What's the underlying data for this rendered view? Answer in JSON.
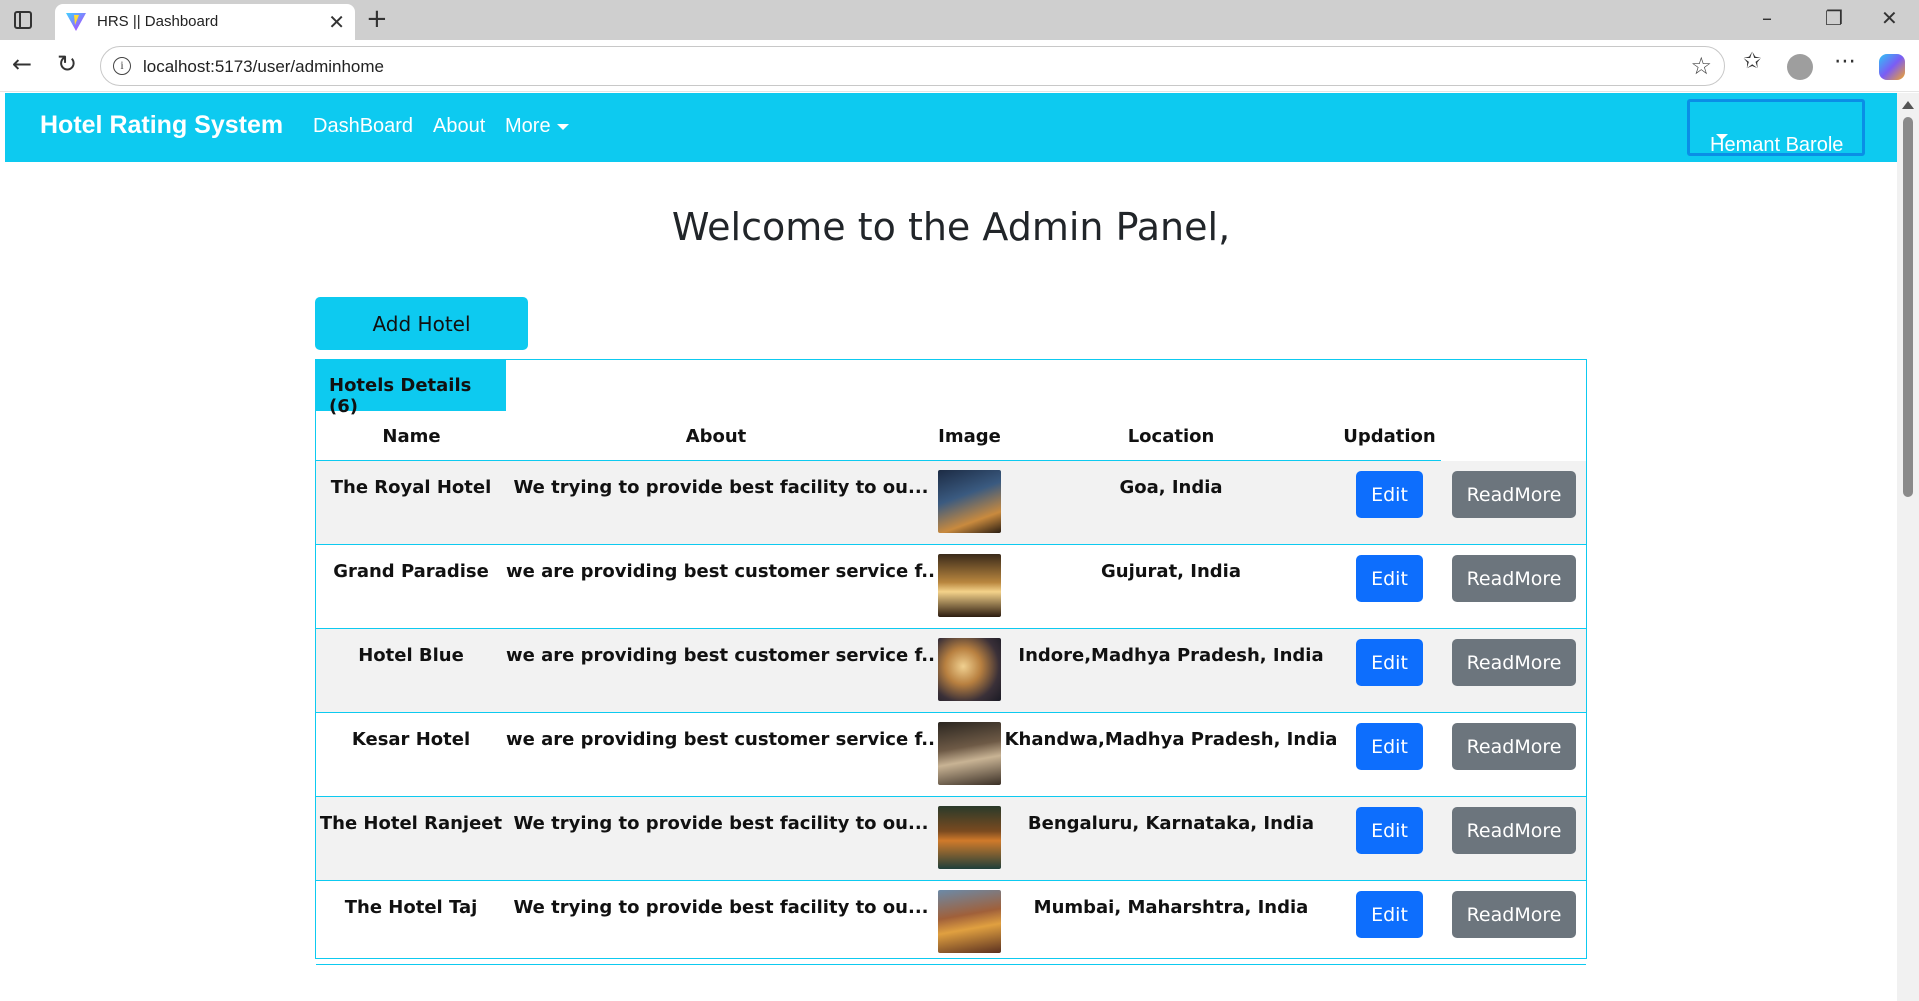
{
  "browser": {
    "tab_title": "HRS || Dashboard",
    "url": "localhost:5173/user/adminhome",
    "icons": [
      "sidebar-toggle-icon",
      "close-icon",
      "plus-icon",
      "minimize-icon",
      "restore-icon",
      "back-icon",
      "reload-icon",
      "info-icon",
      "star-icon",
      "favorites-icon",
      "profile-icon",
      "more-icon",
      "copilot-icon"
    ]
  },
  "navbar": {
    "brand": "Hotel Rating System",
    "links": [
      "DashBoard",
      "About",
      "More"
    ],
    "user": "Hemant Barole"
  },
  "main": {
    "welcome": "Welcome to the Admin Panel,",
    "add_button": "Add Hotel",
    "card_title": "Hotels Details (6)"
  },
  "table": {
    "headers": [
      "Name",
      "About",
      "Image",
      "Location",
      "Updation"
    ],
    "rows": [
      {
        "name": "The Royal Hotel",
        "about": "We trying to provide best facility to ou...",
        "location": "Goa, India",
        "edit": "Edit",
        "readmore": "ReadMore"
      },
      {
        "name": "Grand Paradise",
        "about": "we are providing best customer service f...",
        "location": "Gujurat, India",
        "edit": "Edit",
        "readmore": "ReadMore"
      },
      {
        "name": "Hotel Blue",
        "about": "we are providing best customer service f...",
        "location": "Indore,Madhya Pradesh, India",
        "edit": "Edit",
        "readmore": "ReadMore"
      },
      {
        "name": "Kesar Hotel",
        "about": "we are providing best customer service f...",
        "location": "Khandwa,Madhya Pradesh, India",
        "edit": "Edit",
        "readmore": "ReadMore"
      },
      {
        "name": "The Hotel Ranjeet",
        "about": "We trying to provide best facility to ou...",
        "location": "Bengaluru, Karnataka, India",
        "edit": "Edit",
        "readmore": "ReadMore"
      },
      {
        "name": "The Hotel Taj",
        "about": "We trying to provide best facility to ou...",
        "location": "Mumbai, Maharshtra, India",
        "edit": "Edit",
        "readmore": "ReadMore"
      }
    ]
  },
  "colors": {
    "primary_cyan": "#0dcaf0",
    "edit_blue": "#0d6efd",
    "readmore_gray": "#6c757d"
  }
}
